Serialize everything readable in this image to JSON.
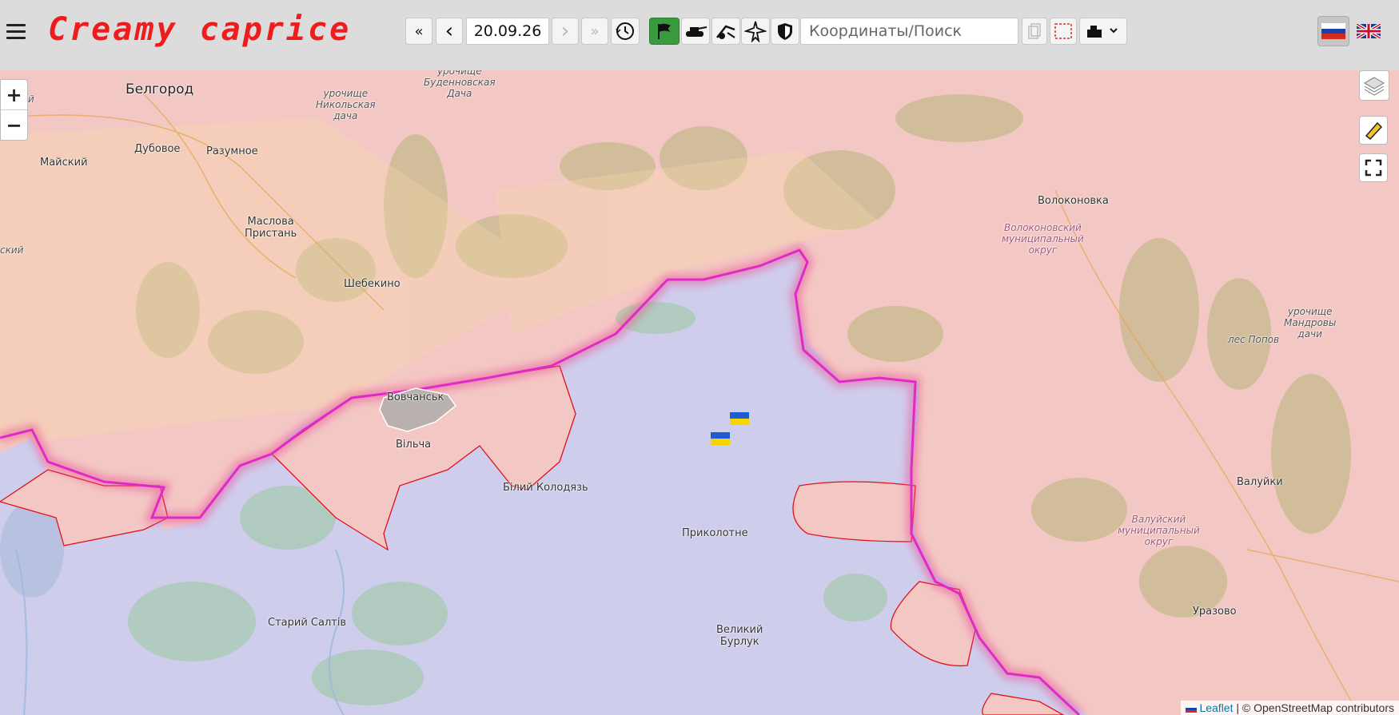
{
  "app": {
    "title": "Creamy caprice"
  },
  "toolbar": {
    "first_label": "«",
    "prev_label": "‹",
    "date_value": "20.09.26",
    "next_label": "›",
    "last_label": "»",
    "search_placeholder": "Координаты/Поиск",
    "icons": [
      "history-clock-icon",
      "flag-icon",
      "tank-icon",
      "artillery-icon",
      "aircraft-icon",
      "shield-icon",
      "copy-icon",
      "frame-select-icon",
      "layer-select-icon"
    ]
  },
  "languages": [
    {
      "code": "ru",
      "selected": true
    },
    {
      "code": "en",
      "selected": false
    }
  ],
  "map": {
    "zoom_in": "+",
    "zoom_out": "−",
    "labels": {
      "belgorod": "Белгород",
      "urochishche_budennovskaya": "урочище\nБуденновская\nДача",
      "urochishche_nikolskaya": "урочище\nНикольская\nдача",
      "dubovoe": "Дубовое",
      "razumnoe": "Разумное",
      "maysky": "Майский",
      "maslova_pristan": "Маслова\nПристань",
      "shebekino": "Шебекино",
      "volokonovka": "Волоконовка",
      "volokonovsky_district": "Волоконовский\nмуниципальный\nокруг",
      "vovchansk": "Вовчанськ",
      "vilcha": "Вільча",
      "bily_kolodyaz": "Білий Колодязь",
      "prikolotne": "Приколотне",
      "stary_saltiv": "Старий Салтів",
      "velyky_burluk": "Великий\nБурлук",
      "valuyki": "Валуйки",
      "valuysky_district": "Валуйский\nмуниципальный\nокруг",
      "urazovo": "Уразово",
      "les_popov": "лес Попов",
      "urochishche_mandrovy": "урочище\nМандровы\nдачи",
      "ky": "кий",
      "skiy": "ский"
    },
    "colors": {
      "occupied": "#f3c8c4",
      "ukraine": "#cfcdec",
      "frontline": "#e02ac8",
      "claim_line": "#e0101a"
    }
  },
  "attribution": {
    "leaflet": "Leaflet",
    "separator": "|",
    "osm": "© OpenStreetMap contributors"
  }
}
